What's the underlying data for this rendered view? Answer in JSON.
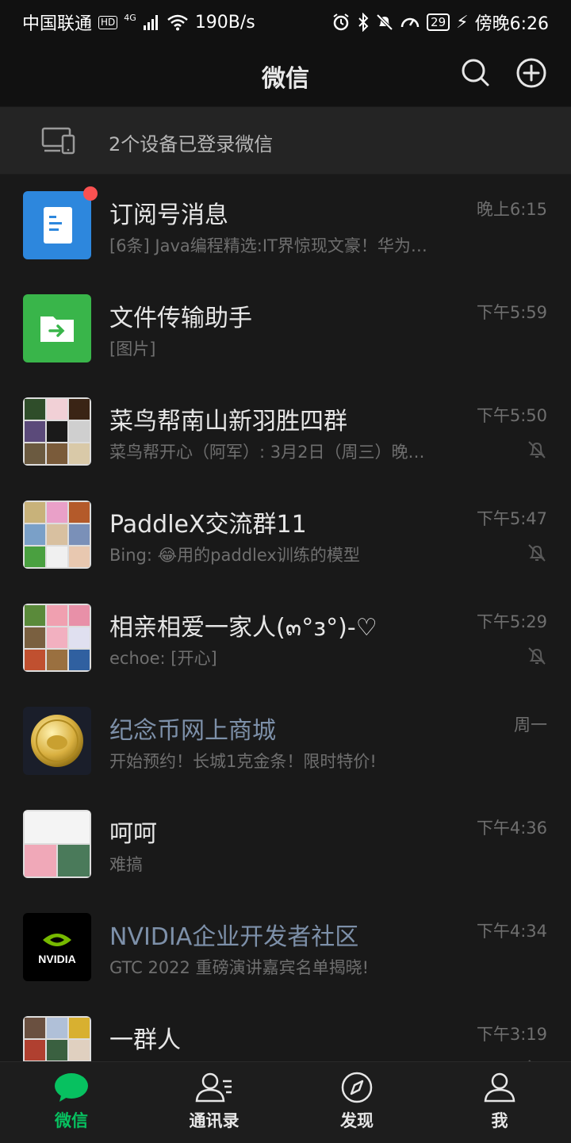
{
  "status_bar": {
    "carrier": "中国联通",
    "hd": "HD",
    "net": "4G",
    "speed": "190B/s",
    "battery": "29",
    "time": "傍晚6:26"
  },
  "nav": {
    "title": "微信",
    "search_icon": "search-icon",
    "add_icon": "plus-circle-icon"
  },
  "devices_banner": {
    "text": "2个设备已登录微信",
    "icon": "devices-icon"
  },
  "chats": [
    {
      "name": "订阅号消息",
      "preview": "[6条] Java编程精选:IT界惊现文豪！华为…",
      "time": "晚上6:15",
      "unread_dot": true,
      "muted": false
    },
    {
      "name": "文件传输助手",
      "preview": "[图片]",
      "time": "下午5:59",
      "unread_dot": false,
      "muted": false
    },
    {
      "name": "菜鸟帮南山新羽胜四群",
      "preview": "菜鸟帮开心（阿军）: 3月2日（周三）晚…",
      "time": "下午5:50",
      "unread_dot": false,
      "muted": true
    },
    {
      "name": "PaddleX交流群11",
      "preview": "Bing: 😂用的paddlex训练的模型",
      "time": "下午5:47",
      "unread_dot": false,
      "muted": true
    },
    {
      "name": "相亲相爱一家人(๓°з°)-♡",
      "preview": "echoe: [开心]",
      "time": "下午5:29",
      "unread_dot": false,
      "muted": true
    },
    {
      "name": "纪念币网上商城",
      "preview": "开始预约！长城1克金条！限时特价!",
      "time": "周一",
      "unread_dot": false,
      "muted": false
    },
    {
      "name": "呵呵",
      "preview": "难搞",
      "time": "下午4:36",
      "unread_dot": false,
      "muted": false
    },
    {
      "name": "NVIDIA企业开发者社区",
      "preview": "GTC 2022 重磅演讲嘉宾名单揭晓!",
      "time": "下午4:34",
      "unread_dot": false,
      "muted": false
    },
    {
      "name": "一群人",
      "preview": "",
      "time": "下午3:19",
      "unread_dot": false,
      "muted": true
    }
  ],
  "avatars": {
    "nvidia_text": "NVIDIA"
  },
  "tabs": [
    {
      "label": "微信",
      "icon": "chat-bubble-icon",
      "active": true
    },
    {
      "label": "通讯录",
      "icon": "contacts-icon",
      "active": false
    },
    {
      "label": "发现",
      "icon": "compass-icon",
      "active": false
    },
    {
      "label": "我",
      "icon": "person-icon",
      "active": false
    }
  ],
  "colors": {
    "accent": "#07c160",
    "background": "#191919",
    "unread": "#fa5151",
    "link_name": "#7d90a9"
  }
}
